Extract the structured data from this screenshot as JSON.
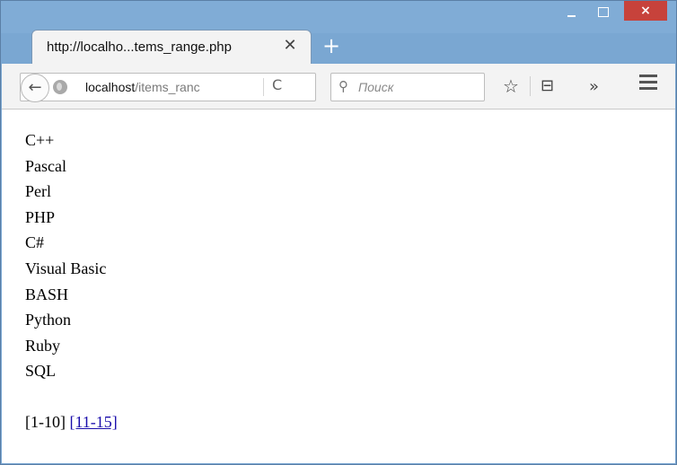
{
  "window": {
    "close_glyph": "×"
  },
  "tab": {
    "title": "http://localho...tems_range.php",
    "close_glyph": "✕",
    "new_tab_glyph": "+"
  },
  "toolbar": {
    "back_glyph": "←",
    "url_host": "localhost",
    "url_path": "/items_ranc",
    "reload_glyph": "C",
    "search_placeholder": "Поиск",
    "search_glyph": "⚲",
    "star_glyph": "☆",
    "reader_glyph": "⊟",
    "overflow_glyph": "»",
    "icons": [
      "back-arrow-icon",
      "globe-icon",
      "reload-icon",
      "search-icon",
      "star-icon",
      "reader-icon",
      "overflow-icon",
      "menu-icon"
    ]
  },
  "languages": [
    "C++",
    "Pascal",
    "Perl",
    "PHP",
    "C#",
    "Visual Basic",
    "BASH",
    "Python",
    "Ruby",
    "SQL"
  ],
  "pager": {
    "current": "[1-10]",
    "next": "[11-15]"
  },
  "colors": {
    "titlebar": "#80acd6",
    "close_button": "#c7423b",
    "link": "#1a0dab"
  }
}
